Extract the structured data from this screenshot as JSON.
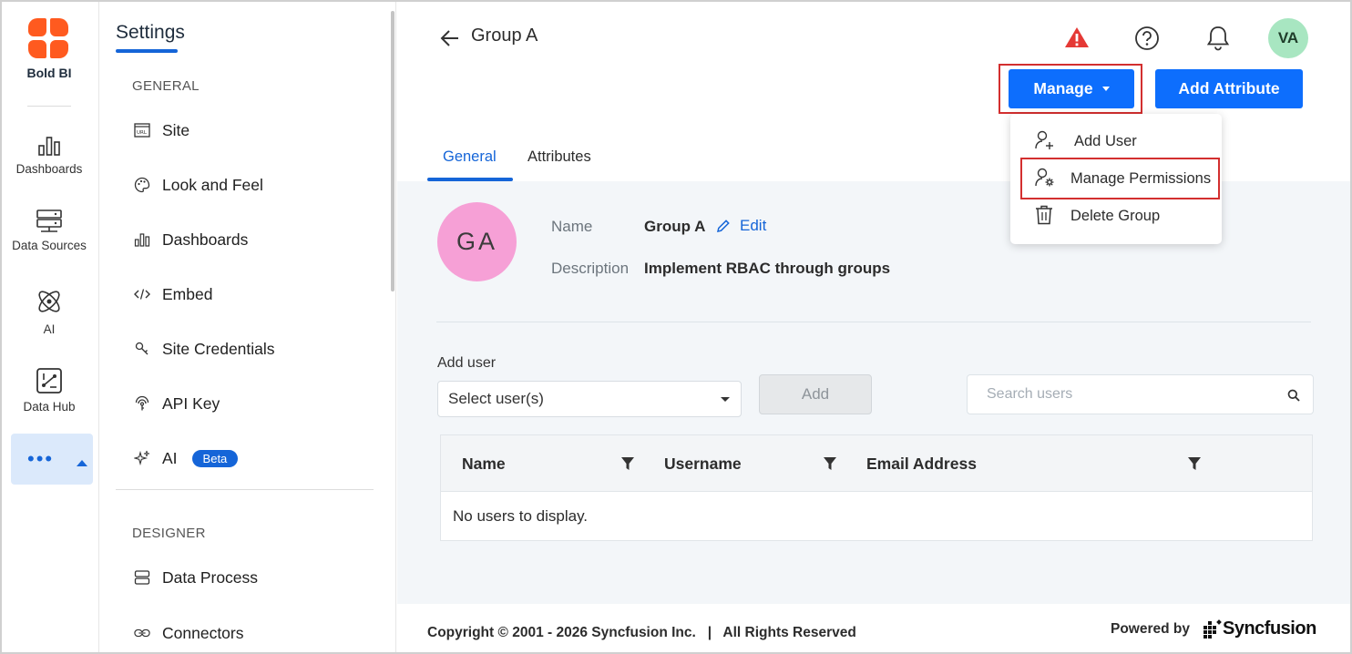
{
  "brand": {
    "name": "Bold BI",
    "color": "#ff5a1f"
  },
  "rail": {
    "items": [
      {
        "label": "Dashboards",
        "icon": "bar-chart-icon"
      },
      {
        "label": "Data Sources",
        "icon": "server-icon"
      },
      {
        "label": "AI",
        "icon": "atom-icon"
      },
      {
        "label": "Data Hub",
        "icon": "data-hub-icon"
      }
    ],
    "more": {
      "label": "•••",
      "icon": "caret-up-icon"
    }
  },
  "settings": {
    "title": "Settings",
    "general_label": "GENERAL",
    "items": [
      {
        "label": "Site",
        "icon": "url-icon"
      },
      {
        "label": "Look and Feel",
        "icon": "palette-icon"
      },
      {
        "label": "Dashboards",
        "icon": "bar-chart-icon"
      },
      {
        "label": "Embed",
        "icon": "code-icon"
      },
      {
        "label": "Site Credentials",
        "icon": "key-icon"
      },
      {
        "label": "API Key",
        "icon": "api-key-icon"
      },
      {
        "label": "AI",
        "icon": "sparkle-icon",
        "badge": "Beta"
      }
    ],
    "designer_label": "DESIGNER",
    "designer_items": [
      {
        "label": "Data Process",
        "icon": "data-process-icon"
      },
      {
        "label": "Connectors",
        "icon": "link-icon"
      }
    ]
  },
  "header": {
    "title": "Group A",
    "avatar_initials": "VA",
    "manage_label": "Manage",
    "add_attribute_label": "Add Attribute"
  },
  "tabs": {
    "general": "General",
    "attributes": "Attributes"
  },
  "group": {
    "initials": "GA",
    "name_label": "Name",
    "name_value": "Group A",
    "edit_label": "Edit",
    "description_label": "Description",
    "description_value": "Implement RBAC through groups"
  },
  "add_user": {
    "label": "Add user",
    "select_value": "Select user(s)",
    "add_button": "Add",
    "search_placeholder": "Search users"
  },
  "table": {
    "columns": [
      "Name",
      "Username",
      "Email Address"
    ],
    "empty_message": "No users to display."
  },
  "menu": {
    "items": [
      {
        "label": "Add User",
        "icon": "add-user-icon"
      },
      {
        "label": "Manage Permissions",
        "icon": "user-settings-icon"
      },
      {
        "label": "Delete Group",
        "icon": "trash-icon"
      }
    ]
  },
  "footer": {
    "copyright": "Copyright © 2001 - 2026 Syncfusion Inc.   |   All Rights Reserved",
    "powered_by": "Powered by",
    "vendor": "Syncfusion"
  },
  "colors": {
    "accent": "#0d6efd",
    "highlight": "#d32f2f",
    "warning": "#e53935"
  }
}
